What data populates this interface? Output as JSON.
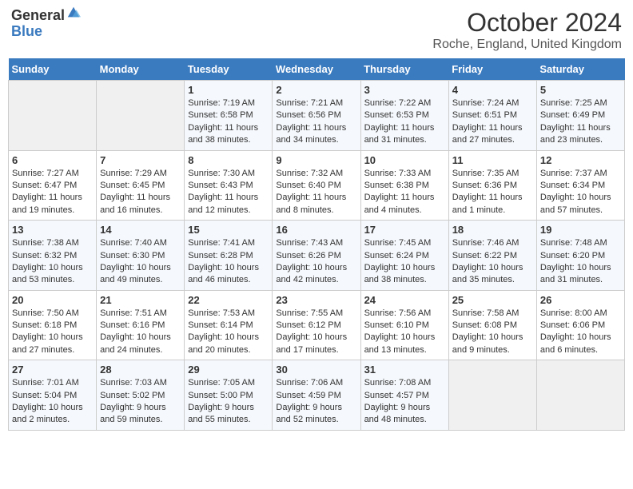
{
  "header": {
    "logo_line1": "General",
    "logo_line2": "Blue",
    "main_title": "October 2024",
    "subtitle": "Roche, England, United Kingdom"
  },
  "days_of_week": [
    "Sunday",
    "Monday",
    "Tuesday",
    "Wednesday",
    "Thursday",
    "Friday",
    "Saturday"
  ],
  "weeks": [
    [
      {
        "day": "",
        "info": ""
      },
      {
        "day": "",
        "info": ""
      },
      {
        "day": "1",
        "info": "Sunrise: 7:19 AM\nSunset: 6:58 PM\nDaylight: 11 hours and 38 minutes."
      },
      {
        "day": "2",
        "info": "Sunrise: 7:21 AM\nSunset: 6:56 PM\nDaylight: 11 hours and 34 minutes."
      },
      {
        "day": "3",
        "info": "Sunrise: 7:22 AM\nSunset: 6:53 PM\nDaylight: 11 hours and 31 minutes."
      },
      {
        "day": "4",
        "info": "Sunrise: 7:24 AM\nSunset: 6:51 PM\nDaylight: 11 hours and 27 minutes."
      },
      {
        "day": "5",
        "info": "Sunrise: 7:25 AM\nSunset: 6:49 PM\nDaylight: 11 hours and 23 minutes."
      }
    ],
    [
      {
        "day": "6",
        "info": "Sunrise: 7:27 AM\nSunset: 6:47 PM\nDaylight: 11 hours and 19 minutes."
      },
      {
        "day": "7",
        "info": "Sunrise: 7:29 AM\nSunset: 6:45 PM\nDaylight: 11 hours and 16 minutes."
      },
      {
        "day": "8",
        "info": "Sunrise: 7:30 AM\nSunset: 6:43 PM\nDaylight: 11 hours and 12 minutes."
      },
      {
        "day": "9",
        "info": "Sunrise: 7:32 AM\nSunset: 6:40 PM\nDaylight: 11 hours and 8 minutes."
      },
      {
        "day": "10",
        "info": "Sunrise: 7:33 AM\nSunset: 6:38 PM\nDaylight: 11 hours and 4 minutes."
      },
      {
        "day": "11",
        "info": "Sunrise: 7:35 AM\nSunset: 6:36 PM\nDaylight: 11 hours and 1 minute."
      },
      {
        "day": "12",
        "info": "Sunrise: 7:37 AM\nSunset: 6:34 PM\nDaylight: 10 hours and 57 minutes."
      }
    ],
    [
      {
        "day": "13",
        "info": "Sunrise: 7:38 AM\nSunset: 6:32 PM\nDaylight: 10 hours and 53 minutes."
      },
      {
        "day": "14",
        "info": "Sunrise: 7:40 AM\nSunset: 6:30 PM\nDaylight: 10 hours and 49 minutes."
      },
      {
        "day": "15",
        "info": "Sunrise: 7:41 AM\nSunset: 6:28 PM\nDaylight: 10 hours and 46 minutes."
      },
      {
        "day": "16",
        "info": "Sunrise: 7:43 AM\nSunset: 6:26 PM\nDaylight: 10 hours and 42 minutes."
      },
      {
        "day": "17",
        "info": "Sunrise: 7:45 AM\nSunset: 6:24 PM\nDaylight: 10 hours and 38 minutes."
      },
      {
        "day": "18",
        "info": "Sunrise: 7:46 AM\nSunset: 6:22 PM\nDaylight: 10 hours and 35 minutes."
      },
      {
        "day": "19",
        "info": "Sunrise: 7:48 AM\nSunset: 6:20 PM\nDaylight: 10 hours and 31 minutes."
      }
    ],
    [
      {
        "day": "20",
        "info": "Sunrise: 7:50 AM\nSunset: 6:18 PM\nDaylight: 10 hours and 27 minutes."
      },
      {
        "day": "21",
        "info": "Sunrise: 7:51 AM\nSunset: 6:16 PM\nDaylight: 10 hours and 24 minutes."
      },
      {
        "day": "22",
        "info": "Sunrise: 7:53 AM\nSunset: 6:14 PM\nDaylight: 10 hours and 20 minutes."
      },
      {
        "day": "23",
        "info": "Sunrise: 7:55 AM\nSunset: 6:12 PM\nDaylight: 10 hours and 17 minutes."
      },
      {
        "day": "24",
        "info": "Sunrise: 7:56 AM\nSunset: 6:10 PM\nDaylight: 10 hours and 13 minutes."
      },
      {
        "day": "25",
        "info": "Sunrise: 7:58 AM\nSunset: 6:08 PM\nDaylight: 10 hours and 9 minutes."
      },
      {
        "day": "26",
        "info": "Sunrise: 8:00 AM\nSunset: 6:06 PM\nDaylight: 10 hours and 6 minutes."
      }
    ],
    [
      {
        "day": "27",
        "info": "Sunrise: 7:01 AM\nSunset: 5:04 PM\nDaylight: 10 hours and 2 minutes."
      },
      {
        "day": "28",
        "info": "Sunrise: 7:03 AM\nSunset: 5:02 PM\nDaylight: 9 hours and 59 minutes."
      },
      {
        "day": "29",
        "info": "Sunrise: 7:05 AM\nSunset: 5:00 PM\nDaylight: 9 hours and 55 minutes."
      },
      {
        "day": "30",
        "info": "Sunrise: 7:06 AM\nSunset: 4:59 PM\nDaylight: 9 hours and 52 minutes."
      },
      {
        "day": "31",
        "info": "Sunrise: 7:08 AM\nSunset: 4:57 PM\nDaylight: 9 hours and 48 minutes."
      },
      {
        "day": "",
        "info": ""
      },
      {
        "day": "",
        "info": ""
      }
    ]
  ]
}
